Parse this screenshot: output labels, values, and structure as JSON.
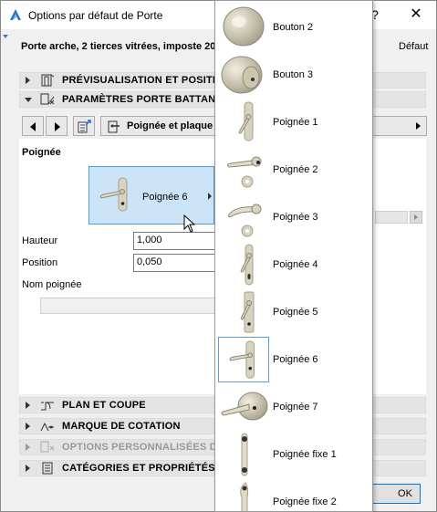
{
  "window": {
    "title": "Options par défaut de Porte",
    "help_glyph": "?",
    "close_glyph": "✕"
  },
  "header": {
    "door_name": "Porte arche, 2 tierces vitrées, imposte 20",
    "default_label": "Défaut"
  },
  "sections": {
    "preview": "PRÉVISUALISATION ET POSITION",
    "swing": "PARAMÈTRES PORTE BATTANTE",
    "plan": "PLAN ET COUPE",
    "dimension": "MARQUE DE COTATION",
    "custom": "OPTIONS PERSONNALISÉES DE M",
    "categories": "CATÉGORIES ET PROPRIÉTÉS"
  },
  "toolbar": {
    "combo_label": "Poignée et plaque l"
  },
  "handle_panel": {
    "heading": "Poignée",
    "selected_label": "Poignée 6",
    "hauteur_label": "Hauteur",
    "hauteur_value": "1,000",
    "position_label": "Position",
    "position_value": "0,050",
    "nom_label": "Nom poignée",
    "nom_value": ""
  },
  "footer": {
    "ok_label": "OK"
  },
  "popup": {
    "items": [
      {
        "label": "Bouton 2",
        "icon": "round-knob-icon"
      },
      {
        "label": "Bouton 3",
        "icon": "round-knob-icon"
      },
      {
        "label": "Poignée 1",
        "icon": "lever-plate-icon"
      },
      {
        "label": "Poignée 2",
        "icon": "lever-rosette-icon"
      },
      {
        "label": "Poignée 3",
        "icon": "lever-rosette-icon"
      },
      {
        "label": "Poignée 4",
        "icon": "lever-plate-icon"
      },
      {
        "label": "Poignée 5",
        "icon": "lever-plate-icon"
      },
      {
        "label": "Poignée 6",
        "icon": "lever-plate-icon",
        "selected": true
      },
      {
        "label": "Poignée 7",
        "icon": "lever-knob-icon"
      },
      {
        "label": "Poignée fixe 1",
        "icon": "fixed-handle-icon"
      },
      {
        "label": "Poignée fixe 2",
        "icon": "fixed-handle-icon"
      }
    ]
  },
  "colors": {
    "accent": "#0078d7",
    "selection_fill": "#cce4f7",
    "selection_border": "#5b9bd5",
    "section_bg": "#e4e4e4",
    "hardware": "#d8d2bf"
  }
}
